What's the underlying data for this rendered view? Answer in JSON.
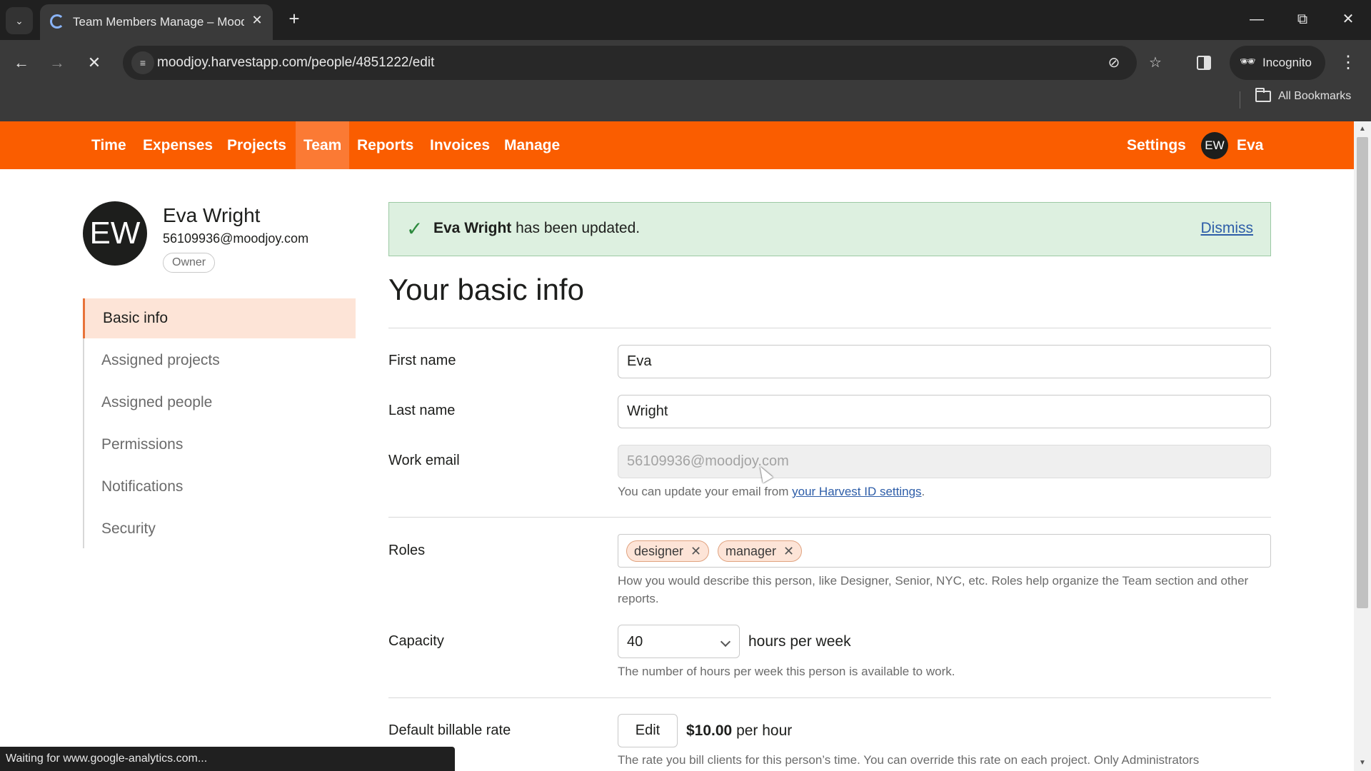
{
  "browser": {
    "tab_title": "Team Members Manage – Moodjoy",
    "url": "moodjoy.harvestapp.com/people/4851222/edit",
    "incognito_label": "Incognito",
    "bookmarks_label": "All Bookmarks",
    "status_text": "Waiting for www.google-analytics.com...",
    "icons": {
      "tab_search": "chevron-down-icon",
      "close_tab": "close-icon",
      "new_tab": "plus-icon",
      "back": "arrow-left-icon",
      "forward": "arrow-right-icon",
      "stop": "close-icon",
      "site_info": "tune-icon",
      "tracking": "eye-off-icon",
      "bookmark": "star-icon"
    }
  },
  "app_nav": {
    "items": [
      {
        "label": "Time",
        "active": false
      },
      {
        "label": "Expenses",
        "active": false
      },
      {
        "label": "Projects",
        "active": false
      },
      {
        "label": "Team",
        "active": true
      },
      {
        "label": "Reports",
        "active": false
      },
      {
        "label": "Invoices",
        "active": false
      },
      {
        "label": "Manage",
        "active": false
      }
    ],
    "settings_label": "Settings",
    "user_initials": "EW",
    "user_name": "Eva",
    "brand_color": "#fa5d00"
  },
  "profile": {
    "initials": "EW",
    "name": "Eva Wright",
    "email": "56109936@moodjoy.com",
    "badge": "Owner"
  },
  "sidenav": {
    "items": [
      {
        "label": "Basic info",
        "active": true
      },
      {
        "label": "Assigned projects",
        "active": false
      },
      {
        "label": "Assigned people",
        "active": false
      },
      {
        "label": "Permissions",
        "active": false
      },
      {
        "label": "Notifications",
        "active": false
      },
      {
        "label": "Security",
        "active": false
      }
    ]
  },
  "flash": {
    "name": "Eva Wright",
    "message": " has been updated.",
    "dismiss_label": "Dismiss"
  },
  "form": {
    "title": "Your basic info",
    "first_name": {
      "label": "First name",
      "value": "Eva"
    },
    "last_name": {
      "label": "Last name",
      "value": "Wright"
    },
    "work_email": {
      "label": "Work email",
      "value": "56109936@moodjoy.com",
      "help_prefix": "You can update your email from ",
      "help_link": "your Harvest ID settings",
      "help_suffix": "."
    },
    "roles": {
      "label": "Roles",
      "tags": [
        "designer",
        "manager"
      ],
      "help": "How you would describe this person, like Designer, Senior, NYC, etc. Roles help organize the Team section and other reports."
    },
    "capacity": {
      "label": "Capacity",
      "value": "40",
      "unit": "hours per week",
      "help": "The number of hours per week this person is available to work."
    },
    "billable_rate": {
      "label": "Default billable rate",
      "edit_label": "Edit",
      "amount": "$10.00",
      "unit": " per hour",
      "help": "The rate you bill clients for this person’s time. You can override this rate on each project. Only Administrators"
    }
  }
}
